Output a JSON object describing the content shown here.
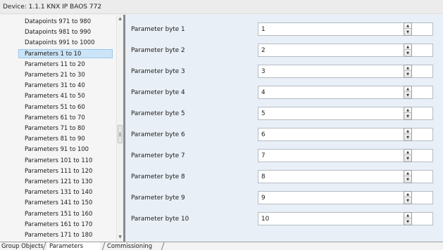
{
  "window": {
    "device_label": "Device: 1.1.1  KNX IP BAOS 772"
  },
  "tree": {
    "items": [
      {
        "label": "Datapoints 971 to 980",
        "selected": false
      },
      {
        "label": "Datapoints 981 to 990",
        "selected": false
      },
      {
        "label": "Datapoints 991 to 1000",
        "selected": false
      },
      {
        "label": "Parameters 1 to 10",
        "selected": true
      },
      {
        "label": "Parameters 11 to 20",
        "selected": false
      },
      {
        "label": "Parameters 21 to 30",
        "selected": false
      },
      {
        "label": "Parameters 31 to 40",
        "selected": false
      },
      {
        "label": "Parameters 41 to 50",
        "selected": false
      },
      {
        "label": "Parameters 51 to 60",
        "selected": false
      },
      {
        "label": "Parameters 61 to 70",
        "selected": false
      },
      {
        "label": "Parameters 71 to 80",
        "selected": false
      },
      {
        "label": "Parameters 81 to 90",
        "selected": false
      },
      {
        "label": "Parameters 91 to 100",
        "selected": false
      },
      {
        "label": "Parameters 101 to 110",
        "selected": false
      },
      {
        "label": "Parameters 111 to 120",
        "selected": false
      },
      {
        "label": "Parameters 121 to 130",
        "selected": false
      },
      {
        "label": "Parameters 131 to 140",
        "selected": false
      },
      {
        "label": "Parameters 141 to 150",
        "selected": false
      },
      {
        "label": "Parameters 151 to 160",
        "selected": false
      },
      {
        "label": "Parameters 161 to 170",
        "selected": false
      },
      {
        "label": "Parameters 171 to 180",
        "selected": false
      }
    ]
  },
  "parameters": [
    {
      "label": "Parameter byte 1",
      "value": "1"
    },
    {
      "label": "Parameter byte 2",
      "value": "2"
    },
    {
      "label": "Parameter byte 3",
      "value": "3"
    },
    {
      "label": "Parameter byte 4",
      "value": "4"
    },
    {
      "label": "Parameter byte 5",
      "value": "5"
    },
    {
      "label": "Parameter byte 6",
      "value": "6"
    },
    {
      "label": "Parameter byte 7",
      "value": "7"
    },
    {
      "label": "Parameter byte 8",
      "value": "8"
    },
    {
      "label": "Parameter byte 9",
      "value": "9"
    },
    {
      "label": "Parameter byte 10",
      "value": "10"
    }
  ],
  "tabs": [
    {
      "label": "Group Objects",
      "active": false
    },
    {
      "label": "Parameters",
      "active": true
    },
    {
      "label": "Commissioning",
      "active": false
    }
  ],
  "icons": {
    "scroll_up": "scroll-up-arrow-icon",
    "scroll_down": "scroll-down-arrow-icon",
    "spin": "spin-button-icon"
  },
  "colors": {
    "selection_bg": "#cce4f7",
    "selection_border": "#99c9ef",
    "param_panel_bg": "#e9eff6",
    "splitter": "#8a8a8a"
  }
}
